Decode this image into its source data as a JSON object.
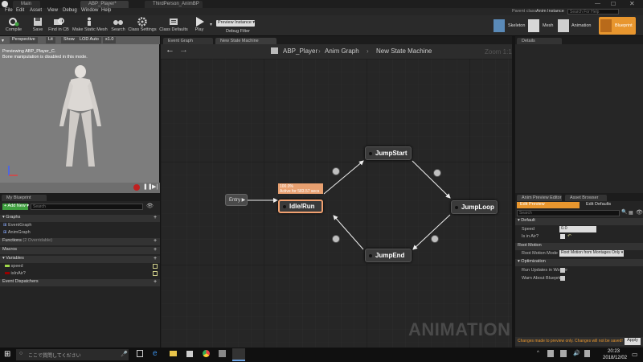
{
  "titlebar": {
    "tabs": [
      "Main",
      "ABP_Player*",
      "ThirdPerson_AnimBP"
    ],
    "parent_class_label": "Parent class:",
    "parent_class_value": "Anim Instance",
    "search_placeholder": "Search For Help"
  },
  "menu": [
    "File",
    "Edit",
    "Asset",
    "View",
    "Debug",
    "Window",
    "Help"
  ],
  "toolbar": {
    "buttons": [
      "Compile",
      "Save",
      "Find in CB",
      "Make Static Mesh",
      "Search",
      "Class Settings",
      "Class Defaults",
      "Play"
    ],
    "debug_select": "Preview Instance",
    "debug_filter": "Debug Filter",
    "modes": [
      "Skeleton",
      "Mesh",
      "Animation",
      "Blueprint"
    ]
  },
  "viewport": {
    "buttons": [
      "Perspective",
      "Lit",
      "Show",
      "LOD Auto",
      "x1.0"
    ],
    "message_1": "Previewing ABP_Player_C.",
    "message_2": "Bone manipulation is disabled in this mode."
  },
  "graph": {
    "tabs": [
      "Event Graph",
      "New State Machine"
    ],
    "breadcrumb": [
      "ABP_Player",
      "Anim Graph",
      "New State Machine"
    ],
    "zoom": "Zoom 1:1",
    "watermark": "ANIMATION",
    "entry_label": "Entry",
    "active_node": {
      "name": "Idle/Run",
      "percent": "100.0%",
      "active_for": "Active for 583.57 secs"
    },
    "nodes": [
      "JumpStart",
      "JumpLoop",
      "JumpEnd"
    ]
  },
  "details": {
    "tab": "Details"
  },
  "blueprint": {
    "tab": "My Blueprint",
    "add_new": "Add New",
    "search_placeholder": "Search",
    "sections": {
      "graphs": "Graphs",
      "graph_items": [
        "EventGraph",
        "AnimGraph"
      ],
      "functions": "Functions",
      "functions_note": "(2 Overridable)",
      "macros": "Macros",
      "variables": "Variables",
      "var_items": [
        "speed",
        "isInAir?"
      ],
      "dispatchers": "Event Dispatchers"
    }
  },
  "preview": {
    "tabs": [
      "Anim Preview Editor",
      "Asset Browser"
    ],
    "subtabs": [
      "Edit Preview",
      "Edit Defaults"
    ],
    "search_placeholder": "Search",
    "default_section": "Default",
    "speed_label": "Speed",
    "speed_value": "0.0",
    "inair_label": "Is in Air?",
    "root_motion_section": "Root Motion",
    "root_motion_mode_label": "Root Motion Mode",
    "root_motion_mode_value": "Root Motion from Montages Only",
    "optimization_section": "Optimization",
    "run_updates_label": "Run Updates in Worker",
    "warn_label": "Warn About Blueprint",
    "status": "Changes made to preview only. Changes will not be saved!",
    "apply": "Apply"
  },
  "taskbar": {
    "search_placeholder": "ここで質問してください",
    "time": "20:23",
    "date": "2018/12/02"
  },
  "colors": {
    "accent_orange": "#e8962e",
    "active_node": "#f0a070",
    "green": "#3fa03f"
  }
}
